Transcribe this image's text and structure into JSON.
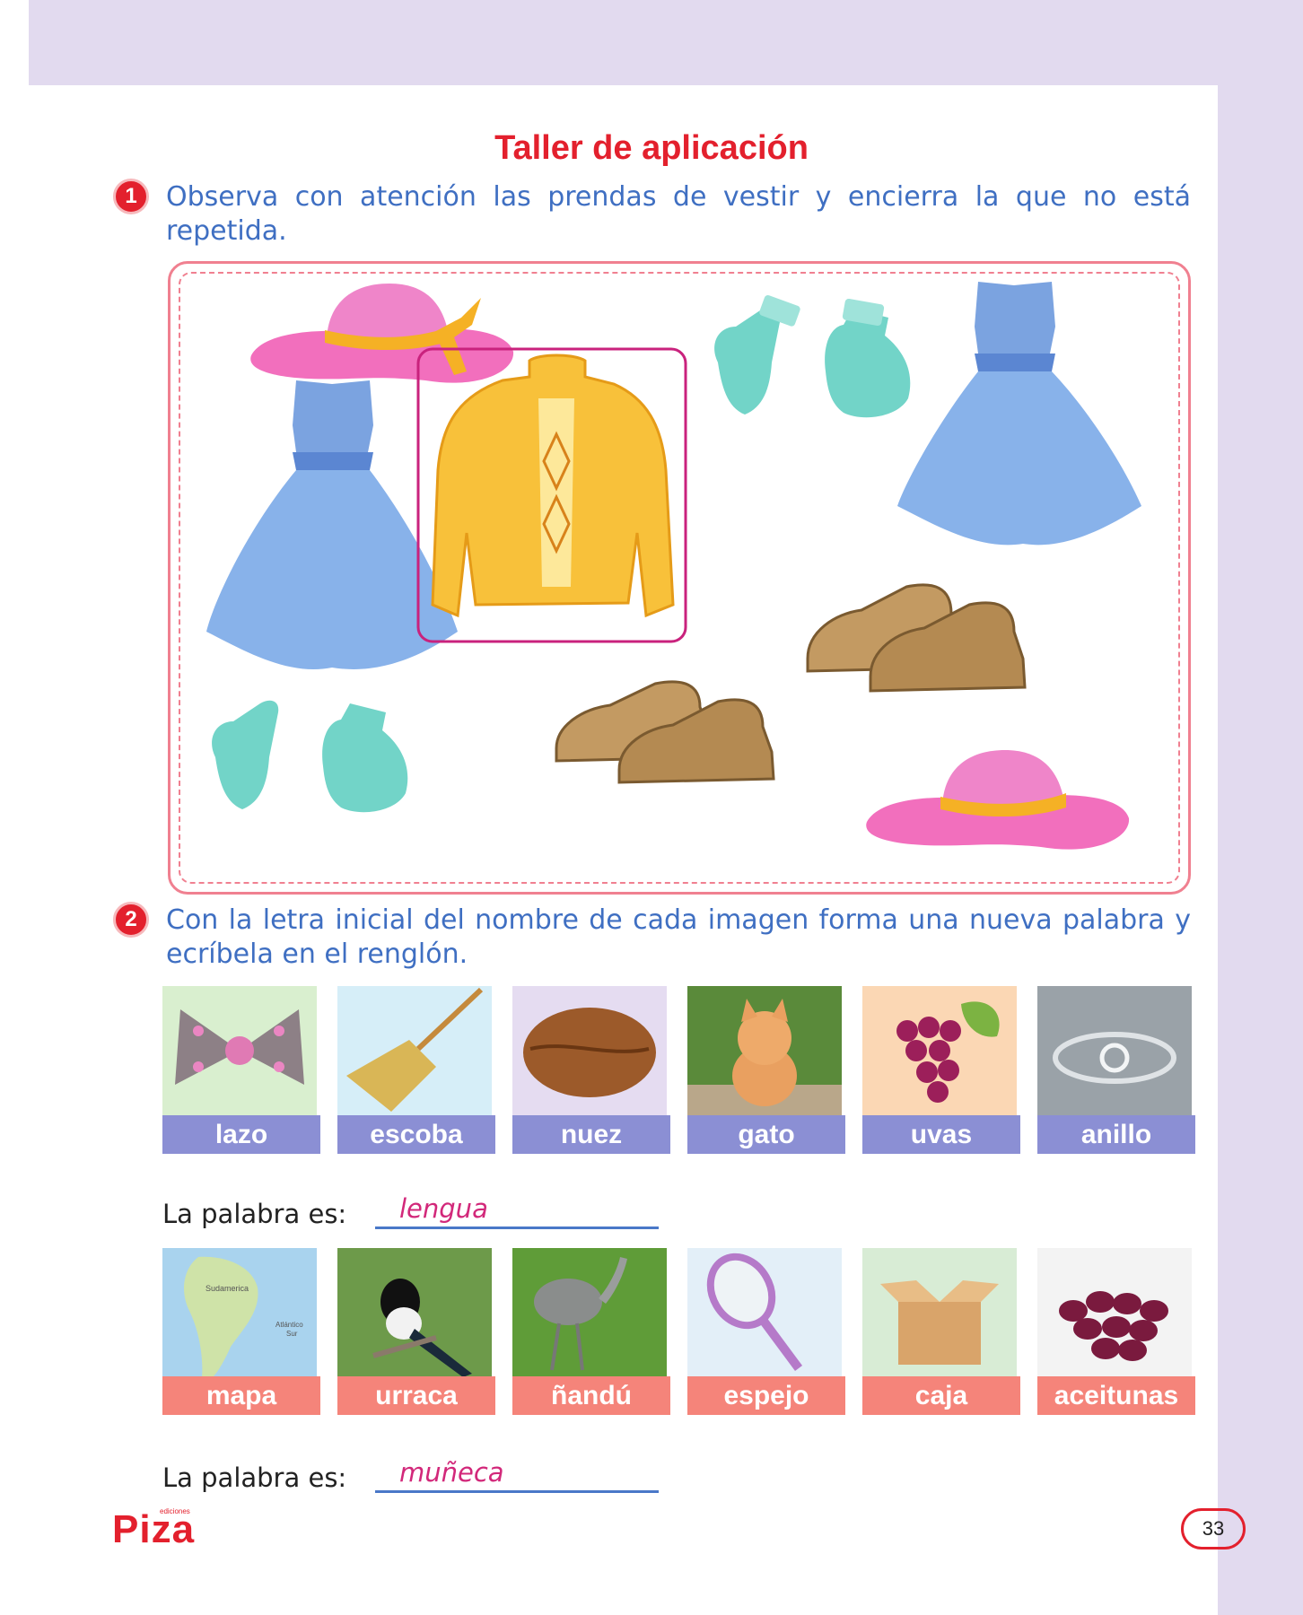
{
  "title": "Taller de aplicación",
  "activity1": {
    "number": "1",
    "instruction": "Observa con atención las prendas de vestir y encierra la que no está repetida."
  },
  "activity2": {
    "number": "2",
    "instruction": "Con la letra inicial del nombre de cada imagen forma una nueva palabra y ecríbela en el renglón.",
    "row1": {
      "items": [
        {
          "label": "lazo",
          "icon": "bow-icon"
        },
        {
          "label": "escoba",
          "icon": "broom-icon"
        },
        {
          "label": "nuez",
          "icon": "walnut-icon"
        },
        {
          "label": "gato",
          "icon": "kitten-icon"
        },
        {
          "label": "uvas",
          "icon": "grapes-icon"
        },
        {
          "label": "anillo",
          "icon": "ring-icon"
        }
      ],
      "answer_label": "La palabra es:",
      "answer": "lengua"
    },
    "row2": {
      "items": [
        {
          "label": "mapa",
          "icon": "map-icon"
        },
        {
          "label": "urraca",
          "icon": "magpie-icon"
        },
        {
          "label": "ñandú",
          "icon": "rhea-icon"
        },
        {
          "label": "espejo",
          "icon": "mirror-icon"
        },
        {
          "label": "caja",
          "icon": "box-icon"
        },
        {
          "label": "aceitunas",
          "icon": "olives-icon"
        }
      ],
      "answer_label": "La palabra es:",
      "answer": "muñeca"
    }
  },
  "map_labels": {
    "continent": "Sudamerica",
    "ocean": "Atlántico",
    "ocean_sub": "Sur"
  },
  "publisher": {
    "name": "Piza",
    "small": "ediciones"
  },
  "page_number": "33",
  "colors": {
    "title": "#e3202d",
    "instruction": "#3f6fc2",
    "label_row1": "#8b8fd4",
    "label_row2": "#f5847a",
    "answer": "#d2287a",
    "band": "#e2daef"
  }
}
